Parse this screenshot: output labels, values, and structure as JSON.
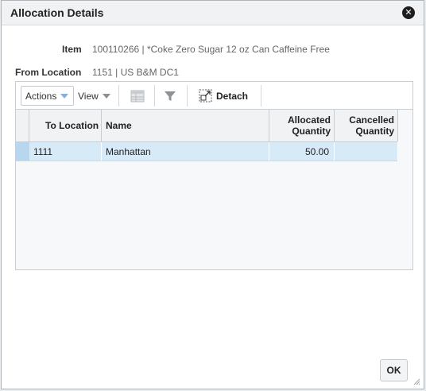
{
  "dialog": {
    "title": "Allocation Details",
    "close_icon": "close-circle-icon"
  },
  "fields": {
    "item_label": "Item",
    "item_value": "100110266 | *Coke Zero Sugar 12 oz Can Caffeine Free",
    "from_location_label": "From Location",
    "from_location_value": "1151 | US B&M DC1"
  },
  "toolbar": {
    "actions_label": "Actions",
    "view_label": "View",
    "freeze_icon": "freeze-columns-icon",
    "filter_icon": "filter-icon",
    "detach_icon": "detach-icon",
    "detach_label": "Detach"
  },
  "table": {
    "headers": {
      "to_location": "To Location",
      "name": "Name",
      "allocated_quantity": "Allocated\nQuantity",
      "cancelled_quantity": "Cancelled\nQuantity"
    },
    "rows": [
      {
        "to_location": "1111",
        "name": "Manhattan",
        "allocated_quantity": "50.00",
        "cancelled_quantity": ""
      }
    ]
  },
  "footer": {
    "ok_label": "OK"
  },
  "colors": {
    "selected_row": "#d6eaf8",
    "dropdown_arrow": "#7fb2de"
  }
}
